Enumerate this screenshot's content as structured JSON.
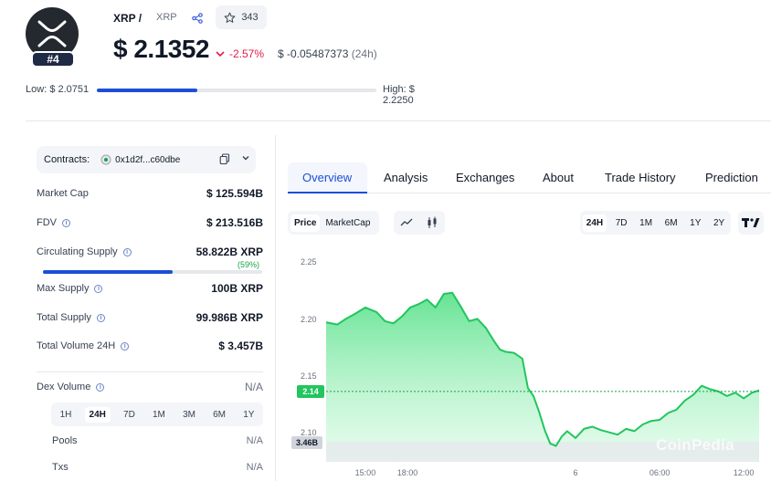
{
  "coin": {
    "name": "XRP /",
    "symbol": "XRP",
    "rank": "#4",
    "watchlist_count": "343",
    "price": "$ 2.1352",
    "change_pct": "-2.57%",
    "change_abs": "$ -0.05487373",
    "change_period": "(24h)",
    "low_label": "Low:",
    "low_value": "$ 2.0751",
    "high_label": "High:",
    "high_value": "$ 2.2250",
    "range_position": 0.36
  },
  "colors": {
    "accent": "#1d4ed8",
    "positive": "#22c55e",
    "negative": "#e11d48",
    "logo_bg": "#23292f"
  },
  "contracts": {
    "label": "Contracts:",
    "address": "0x1d2f...c60dbe"
  },
  "stats": [
    {
      "label": "Market Cap",
      "value": "$ 125.594B",
      "info": false
    },
    {
      "label": "FDV",
      "value": "$ 213.516B",
      "info": true
    },
    {
      "label": "Circulating Supply",
      "value": "58.822B XRP",
      "info": true
    },
    {
      "label": "Max Supply",
      "value": "100B XRP",
      "info": true
    },
    {
      "label": "Total Supply",
      "value": "99.986B XRP",
      "info": true
    },
    {
      "label": "Total Volume 24H",
      "value": "$ 3.457B",
      "info": true
    }
  ],
  "circulating": {
    "pct_label": "(59%)",
    "fraction": 0.59
  },
  "dex": {
    "label": "Dex Volume",
    "value": "N/A",
    "periods": [
      "1H",
      "24H",
      "7D",
      "1M",
      "3M",
      "6M",
      "1Y"
    ],
    "active_period": "24H",
    "pools_label": "Pools",
    "pools_value": "N/A",
    "txs_label": "Txs",
    "txs_value": "N/A"
  },
  "tabs": [
    "Overview",
    "Analysis",
    "Exchanges",
    "About",
    "Trade History",
    "Prediction"
  ],
  "active_tab": "Overview",
  "chart_controls": {
    "modes": [
      "Price",
      "MarketCap"
    ],
    "active_mode": "Price",
    "chart_types": [
      "line-chart-icon",
      "candlestick-icon"
    ],
    "periods": [
      "24H",
      "7D",
      "1M",
      "6M",
      "1Y",
      "2Y"
    ],
    "active_period": "24H"
  },
  "chart_data": {
    "type": "area",
    "title": "",
    "xlabel": "",
    "ylabel": "",
    "x_ticks": [
      "15:00",
      "18:00",
      "6",
      "06:00",
      "12:00"
    ],
    "x_tick_hours": [
      3,
      6,
      18,
      24,
      30
    ],
    "y_ticks": [
      2.25,
      2.2,
      2.15,
      2.1
    ],
    "ylim": [
      2.075,
      2.26
    ],
    "xlim": [
      0.2,
      31.1
    ],
    "current_price_label": "2.14",
    "current_price": 2.137,
    "volume_label": "3.46B",
    "watermark": "CoinPedia",
    "series": [
      {
        "x": [
          0.2,
          1.0,
          1.6,
          2.2,
          3.0,
          3.8,
          4.4,
          5.0,
          5.6,
          6.2,
          6.8,
          7.4,
          8.0,
          8.6,
          9.2,
          9.8,
          10.4,
          11.0,
          11.6,
          12.2,
          12.6,
          13.0,
          13.6,
          14.2,
          14.6,
          15.0,
          15.4,
          15.8,
          16.2,
          16.6,
          17.0,
          17.4,
          18.0,
          18.6,
          19.2,
          19.8,
          20.4,
          21.0,
          21.6,
          22.2,
          22.8,
          23.4,
          24.0,
          24.6,
          25.2,
          25.8,
          26.4,
          27.0,
          27.6,
          28.2,
          28.8,
          29.4,
          30.0,
          30.6,
          31.1
        ],
        "y": [
          2.198,
          2.196,
          2.201,
          2.205,
          2.211,
          2.207,
          2.199,
          2.197,
          2.203,
          2.211,
          2.214,
          2.218,
          2.211,
          2.223,
          2.224,
          2.212,
          2.199,
          2.201,
          2.193,
          2.181,
          2.174,
          2.172,
          2.171,
          2.166,
          2.14,
          2.133,
          2.119,
          2.103,
          2.091,
          2.089,
          2.097,
          2.102,
          2.096,
          2.104,
          2.106,
          2.103,
          2.101,
          2.099,
          2.104,
          2.102,
          2.108,
          2.111,
          2.112,
          2.118,
          2.121,
          2.129,
          2.134,
          2.142,
          2.139,
          2.137,
          2.133,
          2.136,
          2.131,
          2.136,
          2.138
        ]
      }
    ]
  }
}
